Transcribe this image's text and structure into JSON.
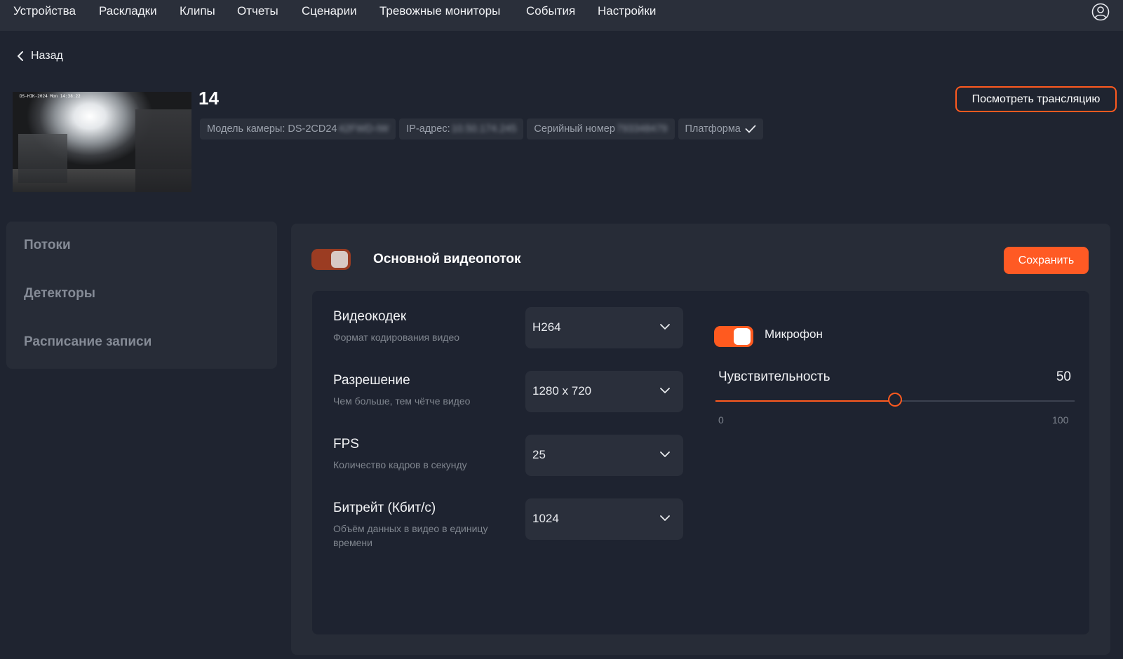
{
  "nav": {
    "items": [
      "Устройства",
      "Раскладки",
      "Клипы",
      "Отчеты",
      "Сценарии",
      "Тревожные мониторы",
      "События",
      "Настройки"
    ]
  },
  "back_label": "Назад",
  "camera": {
    "thumbnail_overlay": "DS-HIK-2024 Mon 14:38:22",
    "title": "14",
    "chips": {
      "model_label": "Модель камеры:",
      "model_value": "DS-2CD24",
      "model_hidden": "42FWD-IW",
      "ip_label": "IP-адрес:",
      "ip_hidden": "10.50.174.245",
      "serial_label": "Серийный номер",
      "serial_hidden": "793348479",
      "platform_label": "Платформа"
    }
  },
  "watch_button": "Посмотреть трансляцию",
  "sidebar": {
    "items": [
      "Потоки",
      "Детекторы",
      "Расписание записи"
    ]
  },
  "stream": {
    "title": "Основной видеопоток",
    "enabled": true,
    "save_label": "Сохранить",
    "settings": [
      {
        "label": "Видеокодек",
        "sub": "Формат кодирования видео",
        "value": "H264"
      },
      {
        "label": "Разрешение",
        "sub": "Чем больше, тем чётче видео",
        "value": "1280 x 720"
      },
      {
        "label": "FPS",
        "sub": "Количество кадров в секунду",
        "value": "25"
      },
      {
        "label": "Битрейт (Кбит/с)",
        "sub": "Объём данных в видео в единицу времени",
        "value": "1024"
      }
    ],
    "microphone": {
      "label": "Микрофон",
      "enabled": true,
      "sensitivity_label": "Чувствительность",
      "sensitivity_value": "50",
      "min": "0",
      "max": "100",
      "level": 50
    }
  },
  "colors": {
    "accent": "#ff5a1f",
    "bg": "#1f2430",
    "panel": "#272c37"
  }
}
